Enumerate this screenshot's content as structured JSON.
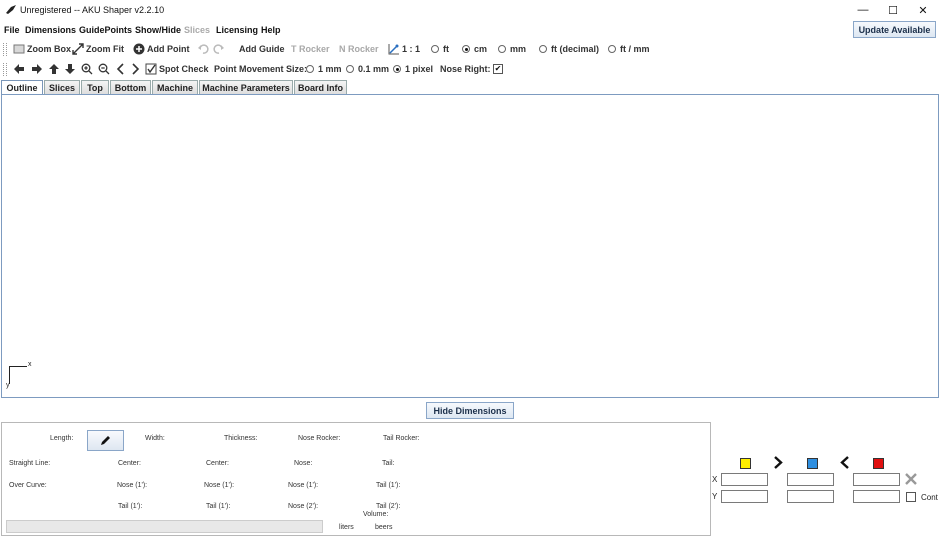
{
  "window": {
    "title": "Unregistered -- AKU Shaper v2.2.10",
    "minimize": "—",
    "maximize": "☐",
    "close": "✕"
  },
  "menu": {
    "items": [
      "File",
      "Dimensions",
      "GuidePoints",
      "Show/Hide",
      "Slices",
      "Licensing",
      "Help"
    ],
    "update_label": "Update Available"
  },
  "toolbar1": {
    "zoom_box": "Zoom Box",
    "zoom_fit": "Zoom Fit",
    "add_point": "Add Point",
    "add_guide": "Add Guide",
    "t_rocker": "T Rocker",
    "n_rocker": "N Rocker",
    "scale": "1 : 1",
    "units": [
      "ft",
      "cm",
      "mm",
      "ft (decimal)",
      "ft / mm"
    ],
    "selected_unit": "cm"
  },
  "toolbar2": {
    "spot_check": "Spot Check",
    "pm_label": "Point Movement Size:",
    "pm_options": [
      "1 mm",
      "0.1 mm",
      "1 pixel"
    ],
    "pm_selected": "1 pixel",
    "nose_right_label": "Nose Right:",
    "nose_right_checked": "✔"
  },
  "tabs": [
    "Outline",
    "Slices",
    "Top",
    "Bottom",
    "Machine",
    "Machine Parameters",
    "Board Info"
  ],
  "active_tab": "Outline",
  "canvas": {
    "axis_x": "x",
    "axis_y": "y"
  },
  "hide_dimensions_label": "Hide Dimensions",
  "dimensions": {
    "length": "Length:",
    "width": "Width:",
    "thickness": "Thickness:",
    "nose_rocker": "Nose Rocker:",
    "tail_rocker": "Tail Rocker:",
    "straight_line": "Straight Line:",
    "center1": "Center:",
    "center2": "Center:",
    "nose": "Nose:",
    "tail": "Tail:",
    "over_curve": "Over Curve:",
    "nose1_a": "Nose (1'):",
    "nose1_b": "Nose (1'):",
    "nose1_c": "Nose (1'):",
    "tail1_a": "Tail (1'):",
    "tail1_b": "Tail (1'):",
    "tail1_c": "Tail (1'):",
    "nose2": "Nose (2'):",
    "tail2": "Tail (2'):",
    "volume": "Volume:",
    "liters": "liters",
    "beers": "beers"
  },
  "right_panel": {
    "x_label": "X",
    "y_label": "Y",
    "cont_label": "Cont",
    "colors": {
      "yellow": "#ffef00",
      "blue": "#2f8fe0",
      "red": "#e01010"
    }
  }
}
